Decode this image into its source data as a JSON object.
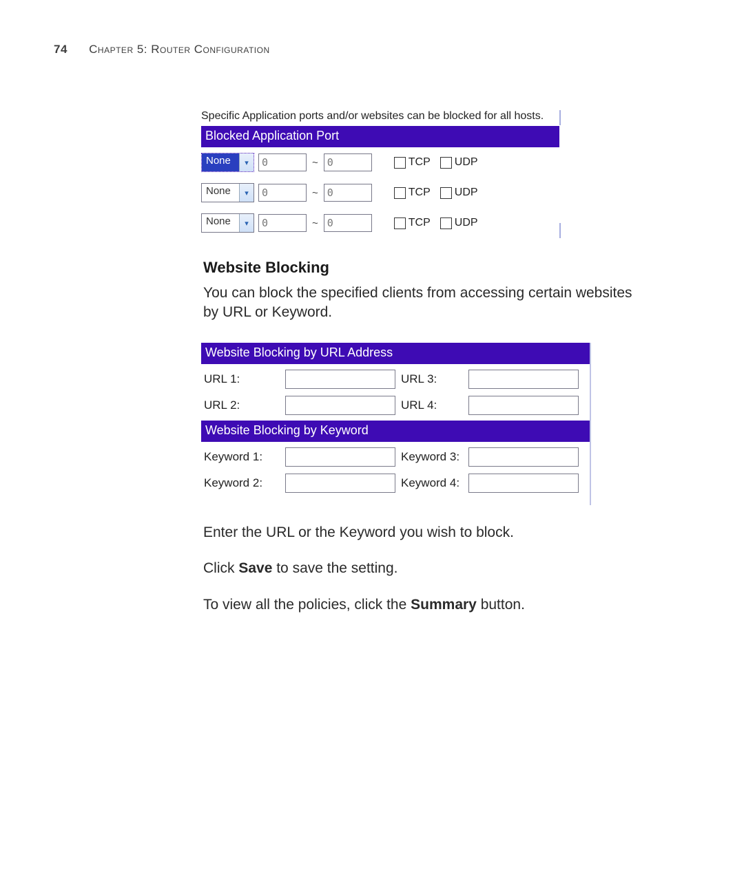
{
  "header": {
    "page_number": "74",
    "chapter_label": "Chapter 5: Router Configuration"
  },
  "shot1": {
    "intro": "Specific Application ports and/or websites can be blocked for all hosts.",
    "bar_title": "Blocked Application Port",
    "rows": [
      {
        "select": "None",
        "highlight": true,
        "from": "0",
        "to": "0"
      },
      {
        "select": "None",
        "highlight": false,
        "from": "0",
        "to": "0"
      },
      {
        "select": "None",
        "highlight": false,
        "from": "0",
        "to": "0"
      }
    ],
    "tcp_label": "TCP",
    "udp_label": "UDP"
  },
  "section2": {
    "heading": "Website Blocking",
    "body": "You can block the specified clients from accessing certain websites by URL or Keyword."
  },
  "shot2": {
    "bar_url": "Website Blocking by URL Address",
    "url_labels": [
      "URL 1:",
      "URL 2:",
      "URL 3:",
      "URL 4:"
    ],
    "bar_kw": "Website Blocking by Keyword",
    "kw_labels": [
      "Keyword 1:",
      "Keyword 2:",
      "Keyword 3:",
      "Keyword 4:"
    ]
  },
  "lower": {
    "p1": "Enter the URL or the Keyword you wish to block.",
    "p2_a": "Click ",
    "p2_b": "Save",
    "p2_c": " to save the setting.",
    "p3_a": "To view all the policies, click the ",
    "p3_b": "Summary",
    "p3_c": " button."
  }
}
